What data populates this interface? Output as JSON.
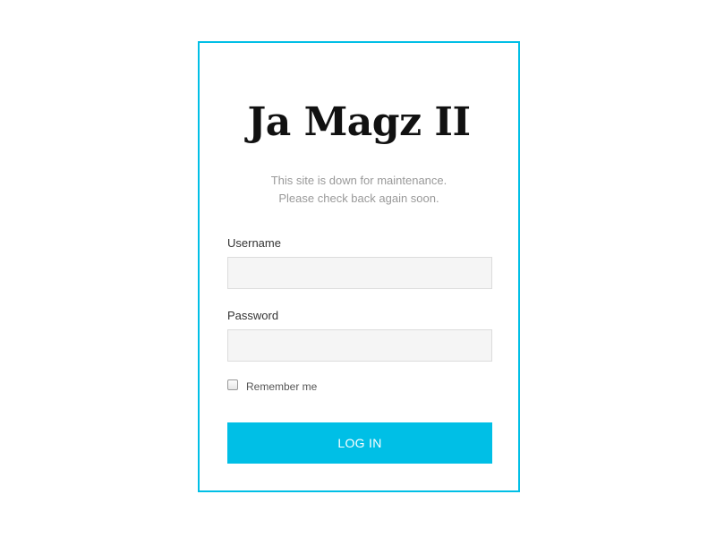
{
  "site": {
    "title": "Ja Magz II"
  },
  "maintenance": {
    "line1": "This site is down for maintenance.",
    "line2": "Please check back again soon."
  },
  "form": {
    "username_label": "Username",
    "username_value": "",
    "password_label": "Password",
    "password_value": "",
    "remember_label": "Remember me",
    "remember_checked": false,
    "login_button_label": "LOG IN"
  },
  "colors": {
    "accent": "#00bfe6",
    "input_background": "#f5f5f5",
    "muted_text": "#999999"
  }
}
